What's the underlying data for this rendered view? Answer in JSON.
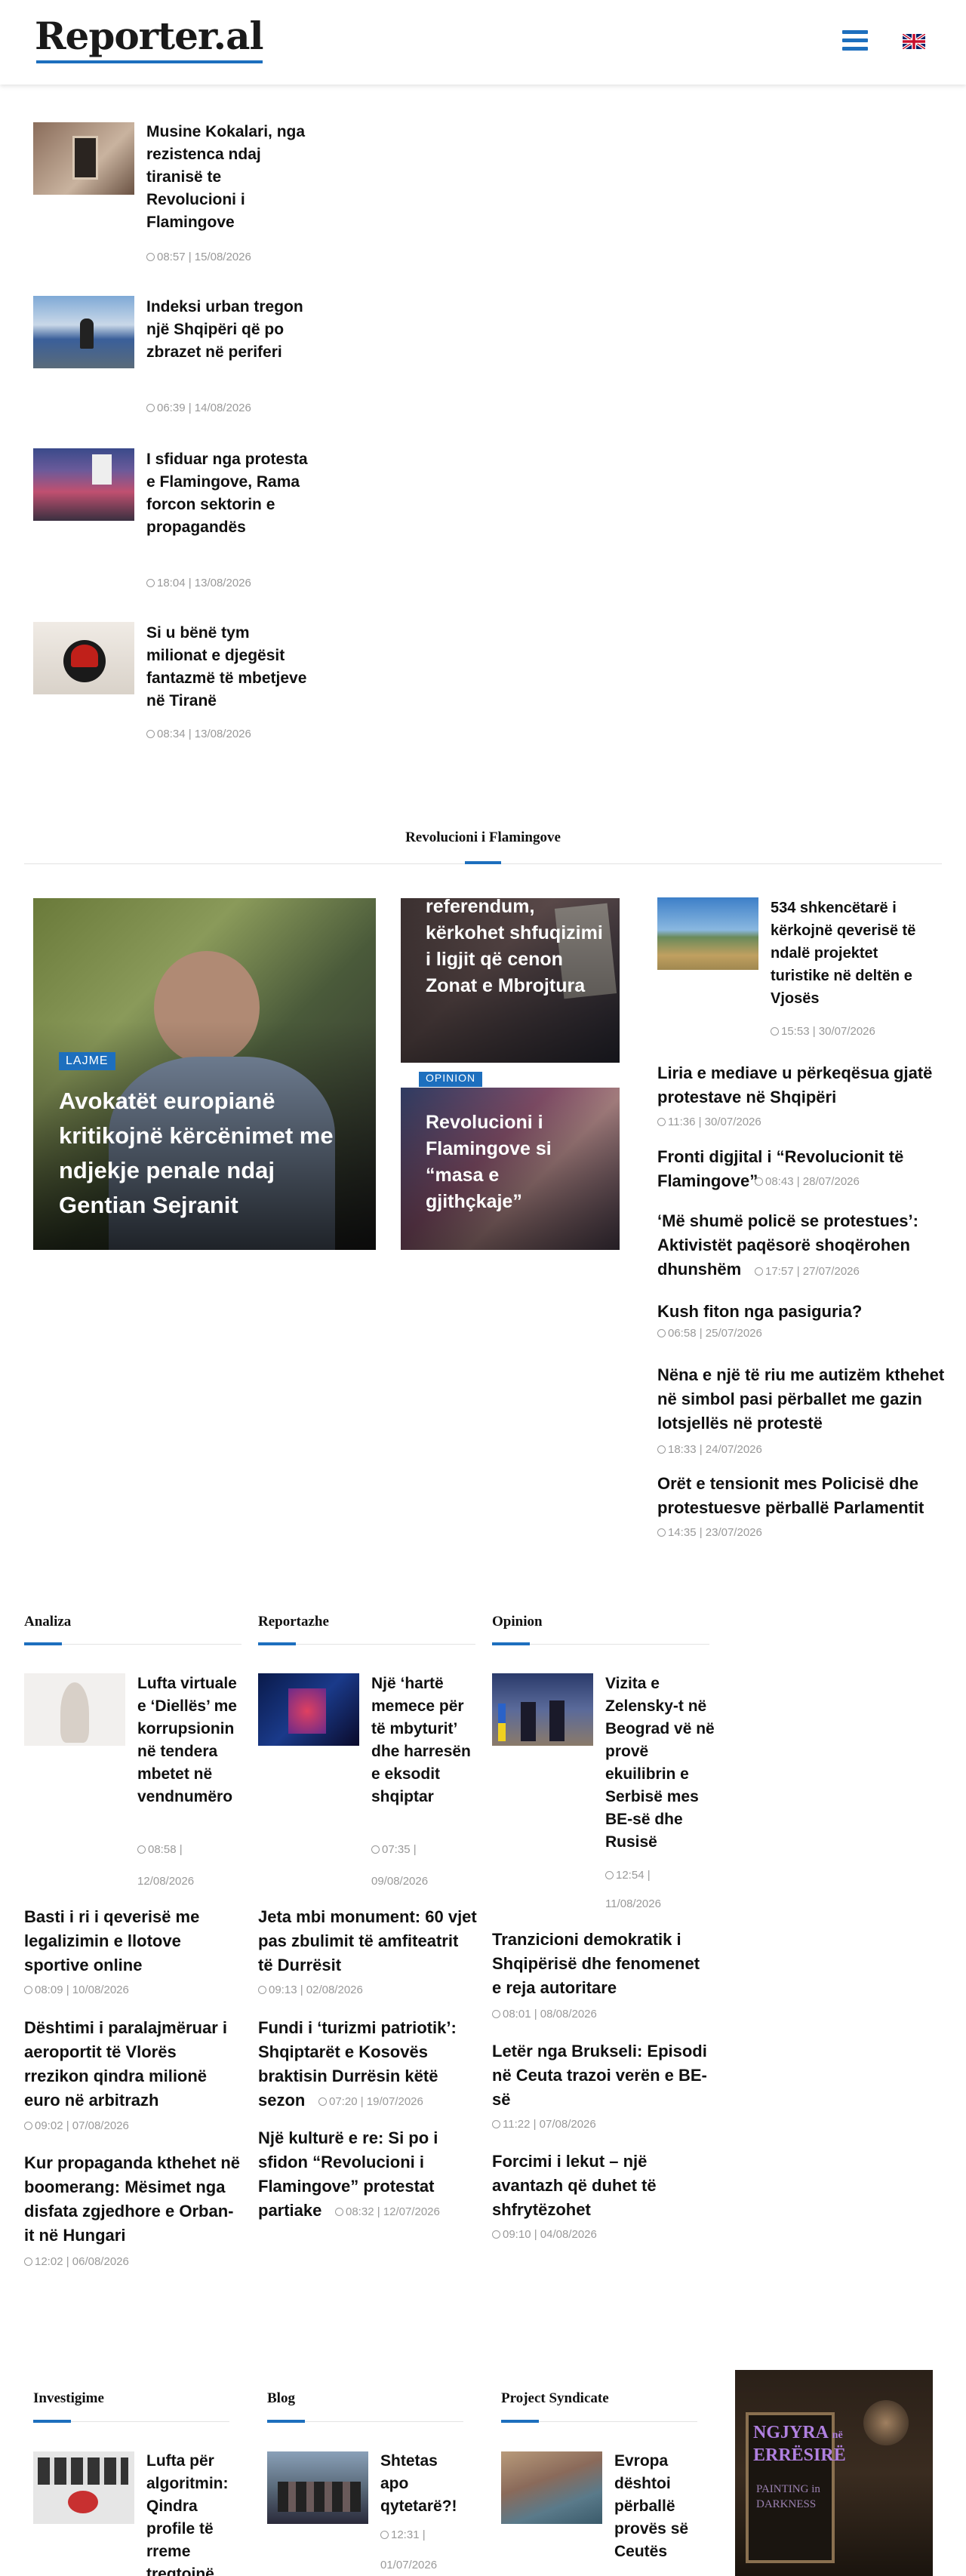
{
  "header": {
    "logo": "Reporter.al",
    "menu_icon": "hamburger-menu-icon",
    "lang_icon": "uk-flag-icon"
  },
  "latest": [
    {
      "title": "Musine Kokalari, nga rezistenca ndaj tiranisë te Revolucioni i Flamingove",
      "meta": "08:57 | 15/08/2026"
    },
    {
      "title": "Indeksi urban tregon një Shqipëri që po zbrazet në periferi",
      "meta": "06:39 | 14/08/2026"
    },
    {
      "title": "I sfiduar nga protesta e Flamingove, Rama forcon sektorin e propagandës",
      "meta": "18:04 | 13/08/2026"
    },
    {
      "title": "Si u bënë tym milionat e djegësit fantazmë të mbetjeve në Tiranë",
      "meta": "08:34 | 13/08/2026"
    }
  ],
  "flamingo": {
    "title": "Revolucioni i Flamingove",
    "main": {
      "badge": "LAJME",
      "title": "Avokatët europianë kritikojnë kërcënimet me ndjekje penale ndaj Gentian Sejranit"
    },
    "mid1": {
      "title": "referendum, kërkohet shfuqizimi i ligjit që cenon Zonat e Mbrojtura"
    },
    "mid2": {
      "badge": "OPINION",
      "title": "Revolucioni i Flamingove si “masa e gjithçkaje”"
    },
    "side_top": {
      "title": "534 shkencëtarë i kërkojnë qeverisë të ndalë projektet turistike në deltën e Vjosës",
      "meta": "15:53 | 30/07/2026"
    },
    "side_list": [
      {
        "title": "Liria e mediave u përkeqësua gjatë protestave në Shqipëri",
        "meta": "11:36 | 30/07/2026"
      },
      {
        "title": "Fronti digjital i “Revolucionit të Flamingove”",
        "meta": "08:43 | 28/07/2026"
      },
      {
        "title": "‘Më shumë policë se protestues’: Aktivistët paqësorë shoqërohen dhunshëm",
        "meta": "17:57 | 27/07/2026"
      },
      {
        "title": "Kush fiton nga pasiguria?",
        "meta": "06:58 | 25/07/2026"
      },
      {
        "title": "Nëna e një të riu me autizëm kthehet në simbol pasi përballet me gazin lotsjellës në protestë",
        "meta": "18:33 | 24/07/2026"
      },
      {
        "title": "Orët e tensionit mes Policisë dhe protestuesve përballë Parlamentit",
        "meta": "14:35 | 23/07/2026"
      }
    ]
  },
  "analiza": {
    "title": "Analiza",
    "feature": {
      "title": "Lufta virtuale e ‘Diellës’ me korrupsionin në tendera mbetet në vendnumëro",
      "meta1": "08:58 |",
      "meta2": "12/08/2026"
    },
    "list": [
      {
        "title": "Basti i ri i qeverisë me legalizimin e llotove sportive online",
        "meta": "08:09 | 10/08/2026"
      },
      {
        "title": "Dështimi i paralajmëruar i aeroportit të Vlorës rrezikon qindra milionë euro në arbitrazh",
        "meta": "09:02 | 07/08/2026"
      },
      {
        "title": "Kur propaganda kthehet në boomerang: Mësimet nga disfata zgjedhore e Orban-it në Hungari",
        "meta": "12:02 | 06/08/2026"
      }
    ]
  },
  "reportazhe": {
    "title": "Reportazhe",
    "feature": {
      "title": "Një ‘hartë memece për të mbyturit’ dhe harresën e eksodit shqiptar",
      "meta1": "07:35 |",
      "meta2": "09/08/2026"
    },
    "list": [
      {
        "title": "Jeta mbi monument: 60 vjet pas zbulimit të amfiteatrit të Durrësit",
        "meta": "09:13 | 02/08/2026"
      },
      {
        "title_lines": [
          "Fundi i ‘turizmi patriotik’:",
          "Shqiptarët e Kosovës",
          "braktisin Durrësin këtë",
          "sezon"
        ],
        "meta": "07:20 | 19/07/2026"
      },
      {
        "title_lines": [
          "Një kulturë e re: Si po i",
          "sfidon “Revolucioni i",
          "Flamingove” protestat",
          "partiake"
        ],
        "meta": "08:32 | 12/07/2026"
      }
    ]
  },
  "opinion": {
    "title": "Opinion",
    "feature": {
      "title": "Vizita e Zelensky-t në Beograd vë në provë ekuilibrin e Serbisë mes BE-së dhe Rusisë",
      "meta1": "12:54 |",
      "meta2": "11/08/2026"
    },
    "list": [
      {
        "title": "Tranzicioni demokratik i Shqipërisë dhe fenomenet e reja autoritare",
        "meta": "08:01 | 08/08/2026"
      },
      {
        "title": "Letër nga Brukseli: Episodi në Ceuta trazoi verën e BE-së",
        "meta": "11:22 | 07/08/2026"
      },
      {
        "title": "Forcimi i lekut – një avantazh që duhet të shfrytëzohet",
        "meta": "09:10 | 04/08/2026"
      }
    ]
  },
  "investigime": {
    "title": "Investigime",
    "feature": {
      "title": "Lufta për algoritmin: Qindra profile të rreme tregtojnë"
    }
  },
  "blog": {
    "title": "Blog",
    "feature": {
      "title": "Shtetas apo qytetarë?!",
      "meta1": "12:31 |",
      "meta2": "01/07/2026"
    }
  },
  "syndicate": {
    "title": "Project Syndicate",
    "feature": {
      "title": "Evropa dështoi përballë provës së Ceutës"
    }
  },
  "ad": {
    "line1": "NGJYRA",
    "line1b": "në",
    "line2": "ERRËSIRË",
    "line3": "PAINTING in",
    "line4": "DARKNESS"
  }
}
